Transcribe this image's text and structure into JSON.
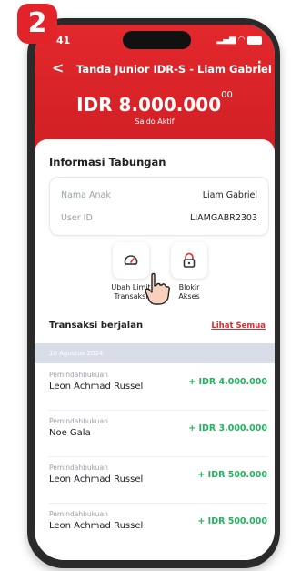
{
  "step_badge": "2",
  "status_bar": {
    "time": "41"
  },
  "header": {
    "title": "Tanda Junior IDR-S - Liam Gabriel",
    "balance_main": "IDR 8.000.000",
    "balance_cents": "00",
    "balance_label": "Saldo Aktif"
  },
  "info": {
    "title": "Informasi Tabungan",
    "rows": [
      {
        "label": "Nama Anak",
        "value": "Liam Gabriel"
      },
      {
        "label": "User ID",
        "value": "LIAMGABR2303"
      }
    ]
  },
  "actions": [
    {
      "label_line1": "Ubah Limit",
      "label_line2": "Transaksi",
      "icon": "speedometer-icon"
    },
    {
      "label_line1": "Blokir",
      "label_line2": "Akses",
      "icon": "lock-icon"
    }
  ],
  "transactions": {
    "title": "Transaksi berjalan",
    "see_all": "Lihat Semua",
    "date": "10 Agustus 2024",
    "items": [
      {
        "type": "Pemindahbukuan",
        "name": "Leon Achmad Russel",
        "amount": "+ IDR 4.000.000"
      },
      {
        "type": "Pemindahbukuan",
        "name": "Noe Gala",
        "amount": "+ IDR 3.000.000"
      },
      {
        "type": "Pemindahbukuan",
        "name": "Leon Achmad Russel",
        "amount": "+ IDR 500.000"
      },
      {
        "type": "Pemindahbukuan",
        "name": "Leon Achmad Russel",
        "amount": "+ IDR 500.000"
      }
    ]
  },
  "colors": {
    "brand_red": "#e2282d",
    "amount_green": "#22b35e",
    "date_bar": "#d8dde8"
  }
}
